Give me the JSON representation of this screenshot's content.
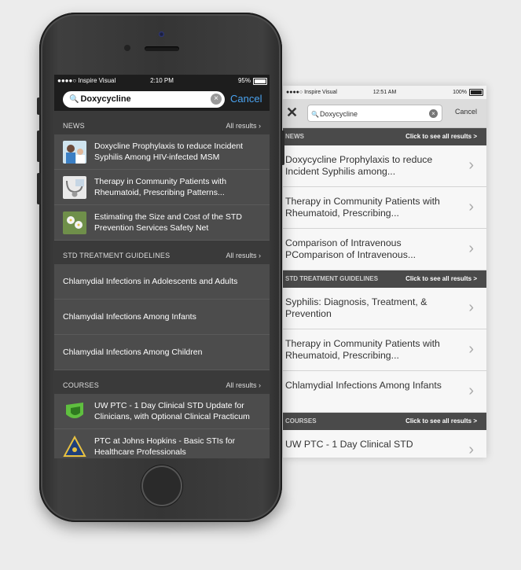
{
  "phone": {
    "status_bar": {
      "carrier": "●●●●○ Inspire Visual",
      "time": "2:10 PM",
      "battery": "95%"
    },
    "search": {
      "value": "Doxycycline",
      "cancel_label": "Cancel"
    },
    "sections": [
      {
        "title": "NEWS",
        "all_results": "All results",
        "items": [
          {
            "text": "Doxycline Prophylaxis to reduce Incident Syphilis Among HIV-infected MSM",
            "thumb_icon": "doctor-child-photo"
          },
          {
            "text": "Therapy in Community Patients with Rheumatoid, Prescribing Patterns...",
            "thumb_icon": "stethoscope-photo"
          },
          {
            "text": "Estimating the Size and Cost of the STD Prevention Services Safety Net",
            "thumb_icon": "flowers-photo"
          }
        ]
      },
      {
        "title": "STD TREATMENT GUIDELINES",
        "all_results": "All results",
        "items": [
          {
            "text": "Chlamydial Infections in Adolescents and Adults"
          },
          {
            "text": "Chlamydial Infections Among Infants"
          },
          {
            "text": "Chlamydial Infections Among Children"
          }
        ]
      },
      {
        "title": "COURSES",
        "all_results": "All results",
        "items": [
          {
            "text": "UW PTC - 1 Day Clinical STD Update for Clinicians, with Optional Clinical Practicum",
            "thumb_icon": "uw-ptc-logo"
          },
          {
            "text": "PTC at Johns Hopkins - Basic STIs for Healthcare Professionals",
            "thumb_icon": "johns-hopkins-logo"
          }
        ]
      }
    ]
  },
  "old_screen": {
    "status_bar": {
      "carrier": "●●●●○ Inspire Visual",
      "time": "12:51 AM",
      "battery": "100%"
    },
    "search": {
      "value": "Doxycycline",
      "cancel_label": "Cancel"
    },
    "sections": [
      {
        "title": "NEWS",
        "all_results": "Click to see all results >",
        "items": [
          {
            "text": "Doxycycline Prophylaxis to reduce Incident Syphilis among..."
          },
          {
            "text": "Therapy in Community Patients with Rheumatoid, Prescribing..."
          },
          {
            "text": "Comparison of Intravenous PComparison of Intravenous..."
          }
        ]
      },
      {
        "title": "STD TREATMENT GUIDELINES",
        "all_results": "Click to see all results >",
        "items": [
          {
            "text": "Syphilis: Diagnosis, Treatment, & Prevention"
          },
          {
            "text": "Therapy in Community Patients with Rheumatoid, Prescribing..."
          },
          {
            "text": "Chlamydial Infections Among Infants"
          }
        ]
      },
      {
        "title": "COURSES",
        "all_results": "Click to see all results >",
        "items": [
          {
            "text": "UW PTC - 1 Day Clinical STD"
          }
        ]
      }
    ]
  },
  "colors": {
    "accent_blue": "#4aa3f0",
    "phone_row": "#4c4c4c",
    "old_section_header": "#4a4a4a"
  }
}
